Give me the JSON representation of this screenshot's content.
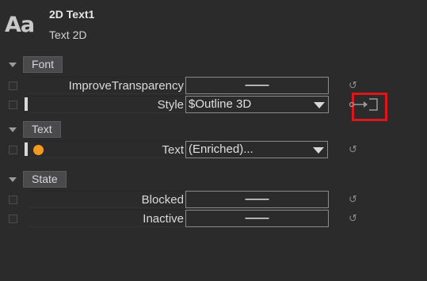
{
  "header": {
    "logo": "Aa",
    "object_name": "2D Text1",
    "object_type": "Text 2D"
  },
  "sections": {
    "font": {
      "label": "Font"
    },
    "text": {
      "label": "Text"
    },
    "state": {
      "label": "State"
    }
  },
  "rows": {
    "improve_transparency": {
      "label": "ImproveTransparency",
      "value": "——"
    },
    "style": {
      "label": "Style",
      "value": "$Outline 3D"
    },
    "text": {
      "label": "Text",
      "value": "(Enriched)..."
    },
    "blocked": {
      "label": "Blocked",
      "value": "——"
    },
    "inactive": {
      "label": "Inactive",
      "value": "——"
    }
  },
  "icons": {
    "reset": "reset-icon",
    "link": "link-connector-icon",
    "section_toggle": "chevron-down-icon"
  },
  "colors": {
    "accent": "#f29b1e",
    "highlight_box": "#e0151b",
    "background": "#2b2b2c"
  }
}
